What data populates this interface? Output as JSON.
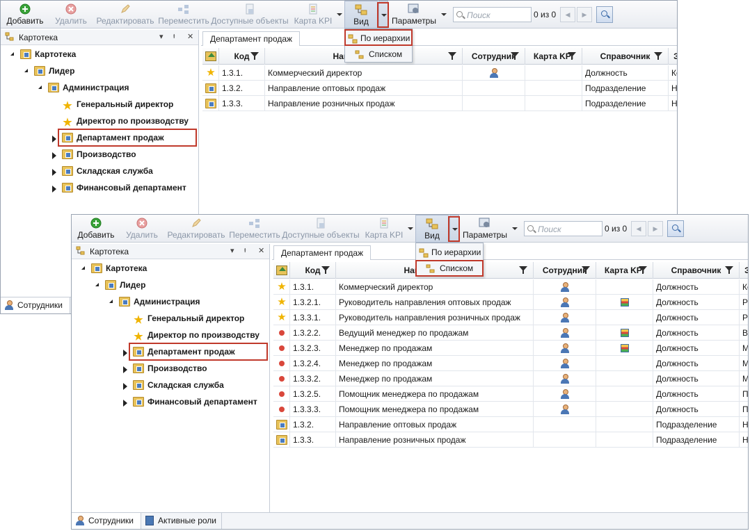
{
  "toolbar": {
    "add": "Добавить",
    "delete": "Удалить",
    "edit": "Редактировать",
    "move": "Переместить",
    "objects": "Доступные объекты",
    "kpi": "Карта KPI",
    "view": "Вид",
    "params": "Параметры",
    "search_placeholder": "Поиск",
    "count": "0 из 0"
  },
  "colors": {
    "accent": "#c0392b",
    "toolbar": "#e9ecf1",
    "folder": "#e8c35a"
  },
  "view_menu": {
    "hierarchy": "По иерархии",
    "list": "Списком"
  },
  "left_panel": {
    "title": "Картотека",
    "tree": [
      "Картотека",
      "Лидер",
      "Администрация",
      "Генеральный директор",
      "Директор по производству",
      "Департамент продаж",
      "Производство",
      "Складская служба",
      "Финансовый департамент"
    ]
  },
  "doc_tab": "Департамент продаж",
  "columns": {
    "code": "Код",
    "name": "Наименование",
    "employee": "Сотрудник",
    "kpi": "Карта KPI",
    "ref": "Справочник",
    "extra": "Зн"
  },
  "w1_rows": [
    {
      "icon": "star",
      "code": "1.3.1.",
      "name": "Коммерческий директор",
      "emp": true,
      "kpi": false,
      "ref": "Должность",
      "extra": "Ко"
    },
    {
      "icon": "folder",
      "code": "1.3.2.",
      "name": "Направление оптовых продаж",
      "emp": false,
      "kpi": false,
      "ref": "Подразделение",
      "extra": "Н"
    },
    {
      "icon": "folder",
      "code": "1.3.3.",
      "name": "Направление розничных продаж",
      "emp": false,
      "kpi": false,
      "ref": "Подразделение",
      "extra": "Н"
    }
  ],
  "w2_rows": [
    {
      "icon": "star",
      "code": "1.3.1.",
      "name": "Коммерческий директор",
      "emp": true,
      "kpi": false,
      "ref": "Должность",
      "extra": "Ко"
    },
    {
      "icon": "star",
      "code": "1.3.2.1.",
      "name": "Руководитель направления оптовых продаж",
      "emp": true,
      "kpi": true,
      "ref": "Должность",
      "extra": "Ру"
    },
    {
      "icon": "star",
      "code": "1.3.3.1.",
      "name": "Руководитель направления розничных продаж",
      "emp": true,
      "kpi": false,
      "ref": "Должность",
      "extra": "Ру"
    },
    {
      "icon": "dot",
      "code": "1.3.2.2.",
      "name": "Ведущий менеджер по продажам",
      "emp": true,
      "kpi": true,
      "ref": "Должность",
      "extra": "Ве"
    },
    {
      "icon": "dot",
      "code": "1.3.2.3.",
      "name": "Менеджер по продажам",
      "emp": true,
      "kpi": true,
      "ref": "Должность",
      "extra": "Ме"
    },
    {
      "icon": "dot",
      "code": "1.3.2.4.",
      "name": "Менеджер по продажам",
      "emp": true,
      "kpi": false,
      "ref": "Должность",
      "extra": "Ме"
    },
    {
      "icon": "dot",
      "code": "1.3.3.2.",
      "name": "Менеджер по продажам",
      "emp": true,
      "kpi": false,
      "ref": "Должность",
      "extra": "Ме"
    },
    {
      "icon": "dot",
      "code": "1.3.2.5.",
      "name": "Помощник менеджера по продажам",
      "emp": true,
      "kpi": false,
      "ref": "Должность",
      "extra": "По"
    },
    {
      "icon": "dot",
      "code": "1.3.3.3.",
      "name": "Помощник менеджера по продажам",
      "emp": true,
      "kpi": false,
      "ref": "Должность",
      "extra": "По"
    },
    {
      "icon": "folder",
      "code": "1.3.2.",
      "name": "Направление оптовых продаж",
      "emp": false,
      "kpi": false,
      "ref": "Подразделение",
      "extra": "Н"
    },
    {
      "icon": "folder",
      "code": "1.3.3.",
      "name": "Направление розничных продаж",
      "emp": false,
      "kpi": false,
      "ref": "Подразделение",
      "extra": "Н"
    }
  ],
  "bottom_tabs": {
    "employees": "Сотрудники",
    "roles": "Активные роли"
  }
}
